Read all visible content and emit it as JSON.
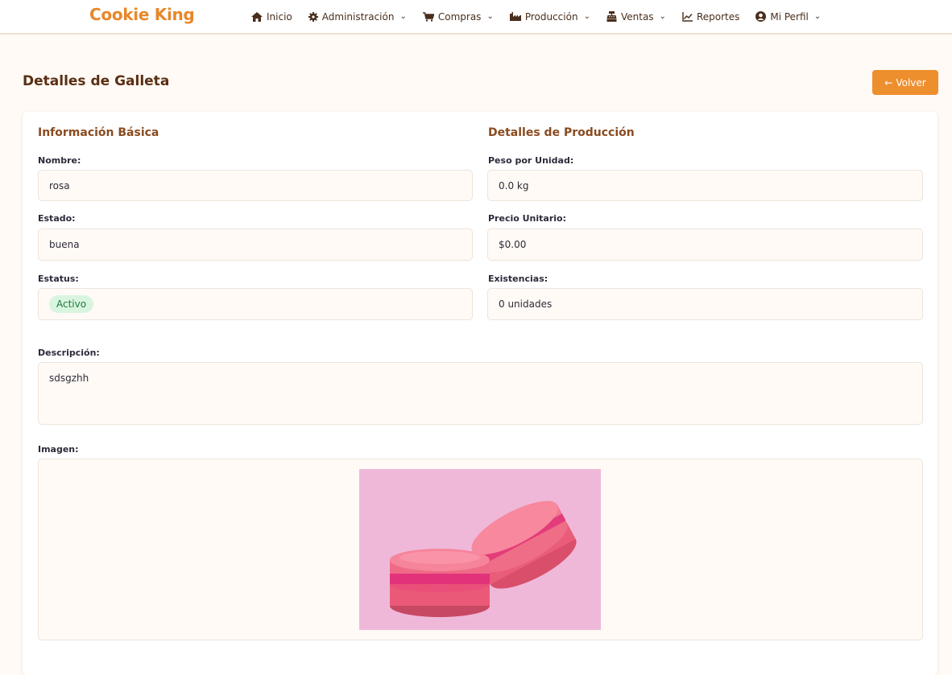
{
  "brand": "Cookie King",
  "nav": {
    "items": [
      {
        "label": "Inicio",
        "icon": "home-icon",
        "dropdown": false
      },
      {
        "label": "Administración",
        "icon": "gear-icon",
        "dropdown": true
      },
      {
        "label": "Compras",
        "icon": "cart-icon",
        "dropdown": true
      },
      {
        "label": "Producción",
        "icon": "factory-icon",
        "dropdown": true
      },
      {
        "label": "Ventas",
        "icon": "cash-register-icon",
        "dropdown": true
      },
      {
        "label": "Reportes",
        "icon": "chart-line-icon",
        "dropdown": false
      },
      {
        "label": "Mi Perfil",
        "icon": "user-circle-icon",
        "dropdown": true
      }
    ]
  },
  "page": {
    "title": "Detalles de Galleta",
    "back_label": "Volver"
  },
  "basic": {
    "title": "Información Básica",
    "name_label": "Nombre:",
    "name_value": "rosa",
    "state_label": "Estado:",
    "state_value": "buena",
    "status_label": "Estatus:",
    "status_value": "Activo"
  },
  "production": {
    "title": "Detalles de Producción",
    "weight_label": "Peso por Unidad:",
    "weight_value": "0.0 kg",
    "price_label": "Precio Unitario:",
    "price_value": "$0.00",
    "stock_label": "Existencias:",
    "stock_value": "0 unidades"
  },
  "description": {
    "label": "Descripción:",
    "value": "sdsgzhh"
  },
  "image": {
    "label": "Imagen:"
  },
  "colors": {
    "accent": "#e8872a",
    "button": "#ee8f2e",
    "heading": "#5a2f14",
    "section": "#8a4b20",
    "badge_bg": "#d9f5df",
    "badge_text": "#1f7a3b"
  }
}
